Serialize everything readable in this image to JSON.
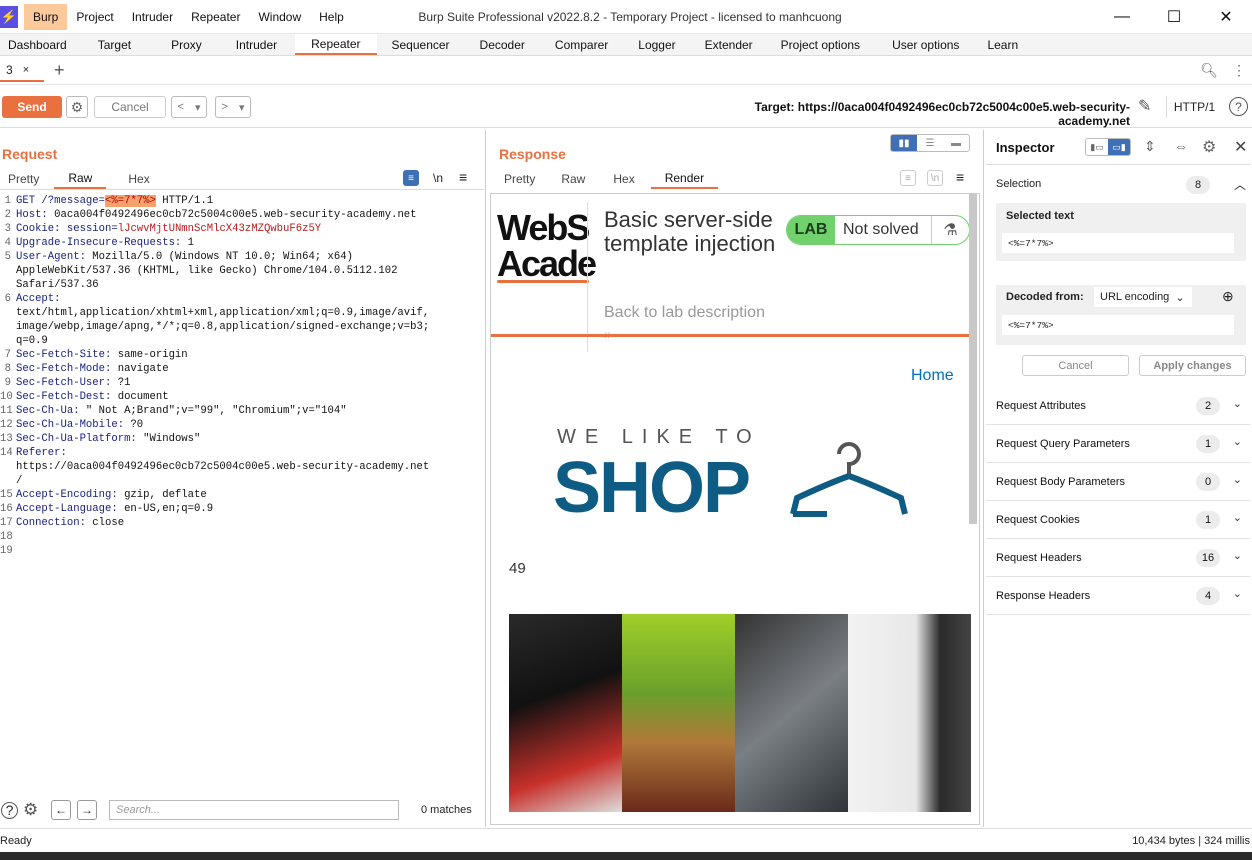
{
  "window": {
    "title": "Burp Suite Professional v2022.8.2 - Temporary Project - licensed to manhcuong",
    "menu": [
      "Burp",
      "Project",
      "Intruder",
      "Repeater",
      "Window",
      "Help"
    ]
  },
  "tabs": [
    "Dashboard",
    "Target",
    "Proxy",
    "Intruder",
    "Repeater",
    "Sequencer",
    "Decoder",
    "Comparer",
    "Logger",
    "Extender",
    "Project options",
    "User options",
    "Learn"
  ],
  "repeater_tab": {
    "label": "3",
    "close": "×"
  },
  "toolbar": {
    "send": "Send",
    "cancel": "Cancel",
    "target_label": "Target: https://0aca004f0492496ec0cb72c5004c00e5.web-security-academy.net",
    "protocol": "HTTP/1"
  },
  "request": {
    "title": "Request",
    "views": [
      "Pretty",
      "Raw",
      "Hex"
    ],
    "newline_toggle": "\\n",
    "lines": [
      {
        "n": "1",
        "k": "GET /?message=",
        "h": "<%=7*7%>",
        "v": " HTTP/1.1"
      },
      {
        "n": "2",
        "k": "Host:",
        "v": " 0aca004f0492496ec0cb72c5004c00e5.web-security-academy.net"
      },
      {
        "n": "3",
        "k": "Cookie:",
        "c": " session=",
        "r": "lJcwvMjtUNmnScMlcX43zMZQwbuF6z5Y"
      },
      {
        "n": "4",
        "k": "Upgrade-Insecure-Requests:",
        "v": " 1"
      },
      {
        "n": "5",
        "k": "User-Agent:",
        "v": " Mozilla/5.0 (Windows NT 10.0; Win64; x64)"
      },
      {
        "n": "",
        "v": "AppleWebKit/537.36 (KHTML, like Gecko) Chrome/104.0.5112.102"
      },
      {
        "n": "",
        "v": "Safari/537.36"
      },
      {
        "n": "6",
        "k": "Accept:"
      },
      {
        "n": "",
        "v": "text/html,application/xhtml+xml,application/xml;q=0.9,image/avif,"
      },
      {
        "n": "",
        "v": "image/webp,image/apng,*/*;q=0.8,application/signed-exchange;v=b3;"
      },
      {
        "n": "",
        "v": "q=0.9"
      },
      {
        "n": "7",
        "k": "Sec-Fetch-Site:",
        "v": " same-origin"
      },
      {
        "n": "8",
        "k": "Sec-Fetch-Mode:",
        "v": " navigate"
      },
      {
        "n": "9",
        "k": "Sec-Fetch-User:",
        "v": " ?1"
      },
      {
        "n": "10",
        "k": "Sec-Fetch-Dest:",
        "v": " document"
      },
      {
        "n": "11",
        "k": "Sec-Ch-Ua:",
        "v": " \" Not A;Brand\";v=\"99\", \"Chromium\";v=\"104\""
      },
      {
        "n": "12",
        "k": "Sec-Ch-Ua-Mobile:",
        "v": " ?0"
      },
      {
        "n": "13",
        "k": "Sec-Ch-Ua-Platform:",
        "v": " \"Windows\""
      },
      {
        "n": "14",
        "k": "Referer:"
      },
      {
        "n": "",
        "v": "https://0aca004f0492496ec0cb72c5004c00e5.web-security-academy.net"
      },
      {
        "n": "",
        "v": "/"
      },
      {
        "n": "15",
        "k": "Accept-Encoding:",
        "v": " gzip, deflate"
      },
      {
        "n": "16",
        "k": "Accept-Language:",
        "v": " en-US,en;q=0.9"
      },
      {
        "n": "17",
        "k": "Connection:",
        "v": " close"
      },
      {
        "n": "18",
        "v": ""
      },
      {
        "n": "19",
        "v": ""
      }
    ],
    "search_placeholder": "Search...",
    "matches": "0 matches"
  },
  "response": {
    "title": "Response",
    "views": [
      "Pretty",
      "Raw",
      "Hex",
      "Render"
    ],
    "lab": {
      "logo_top": "WebS",
      "logo_bottom": "Acade",
      "title": "Basic server-side template injection",
      "badge": "LAB",
      "status": "Not solved",
      "back": "Back to lab description",
      "chevrons": "»"
    },
    "home": "Home",
    "shop_tag": "WE LIKE TO",
    "shop": "SHOP",
    "output": "49"
  },
  "inspector": {
    "title": "Inspector",
    "selection_label": "Selection",
    "selection_count": "8",
    "selected_text_label": "Selected text",
    "selected_text": "<%=7*7%>",
    "decoded_from": "Decoded from:",
    "encoding": "URL encoding",
    "decoded_value": "<%=7*7%>",
    "cancel": "Cancel",
    "apply": "Apply changes",
    "sections": [
      {
        "label": "Request Attributes",
        "count": "2"
      },
      {
        "label": "Request Query Parameters",
        "count": "1"
      },
      {
        "label": "Request Body Parameters",
        "count": "0"
      },
      {
        "label": "Request Cookies",
        "count": "1"
      },
      {
        "label": "Request Headers",
        "count": "16"
      },
      {
        "label": "Response Headers",
        "count": "4"
      }
    ]
  },
  "status": {
    "left": "Ready",
    "right": "10,434 bytes | 324 millis"
  },
  "colors": {
    "accent": "#e8713f",
    "lab_green": "#70d16d",
    "shop_blue": "#0e5c84",
    "link_blue": "#0071bc"
  }
}
